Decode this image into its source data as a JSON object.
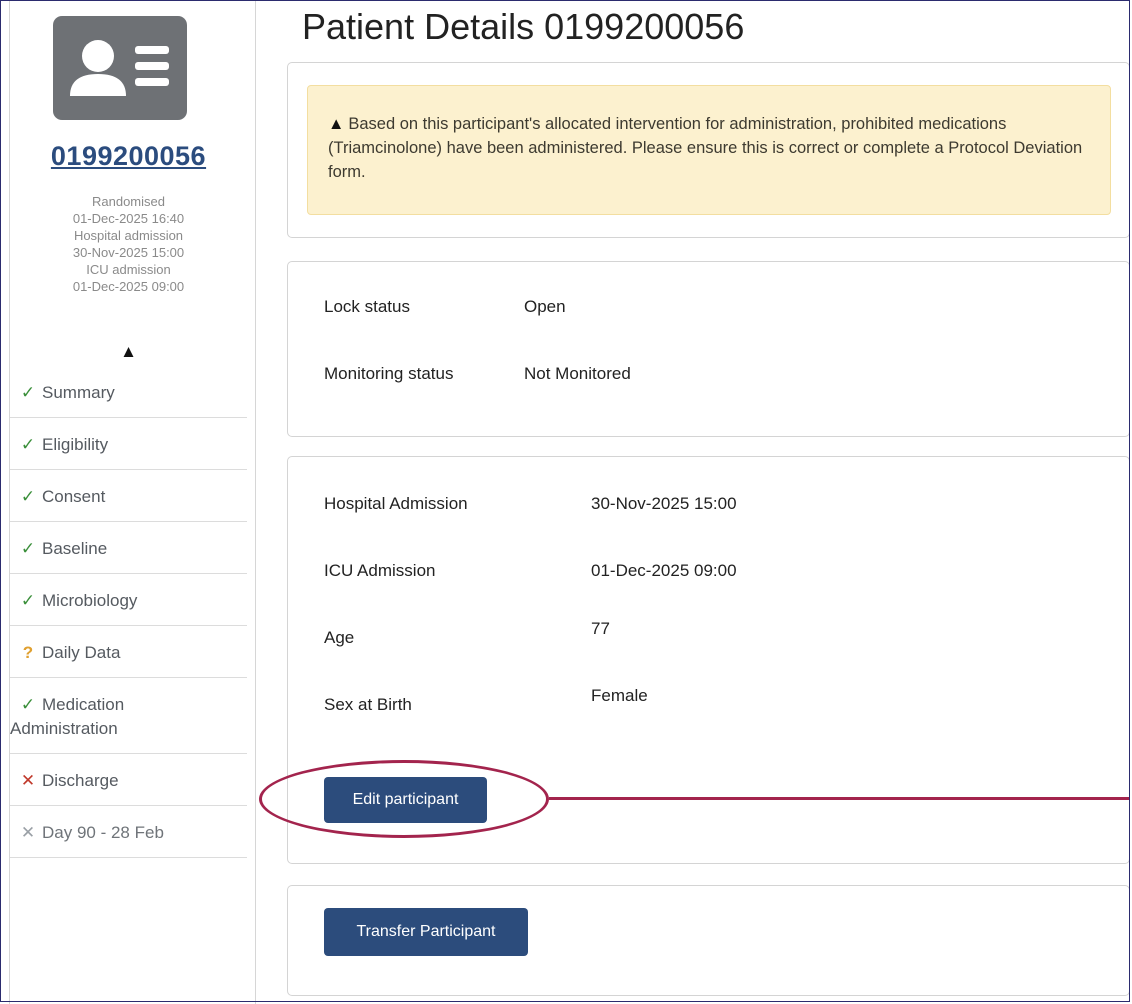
{
  "sidebar": {
    "participant_id": "0199200056",
    "meta": [
      "Randomised",
      "01-Dec-2025 16:40",
      "Hospital admission",
      "30-Nov-2025 15:00",
      "ICU admission",
      "01-Dec-2025 09:00"
    ],
    "warning_glyph": "▲",
    "items": [
      {
        "icon": "✓",
        "label": "Summary",
        "status": "complete"
      },
      {
        "icon": "✓",
        "label": "Eligibility",
        "status": "complete"
      },
      {
        "icon": "✓",
        "label": "Consent",
        "status": "complete"
      },
      {
        "icon": "✓",
        "label": "Baseline",
        "status": "complete"
      },
      {
        "icon": "✓",
        "label": "Microbiology",
        "status": "complete"
      },
      {
        "icon": "?",
        "label": "Daily Data",
        "status": "incomplete"
      },
      {
        "icon": "✓",
        "label_line1": "Medication",
        "label_line2": "Administration",
        "status": "complete"
      },
      {
        "icon": "✕",
        "label": "Discharge",
        "status": "missing"
      },
      {
        "icon": "✕",
        "label": "Day 90 - 28 Feb",
        "status": "not-due"
      }
    ]
  },
  "main": {
    "title": "Patient Details 0199200056",
    "alert": {
      "icon": "▲",
      "text": "Based on this participant's allocated intervention for administration, prohibited medications (Triamcinolone) have been administered. Please ensure this is correct or complete a Protocol Deviation form."
    },
    "status": {
      "lock_label": "Lock status",
      "lock_value": "Open",
      "monitoring_label": "Monitoring status",
      "monitoring_value": "Not Monitored"
    },
    "details": {
      "hospital_admission_label": "Hospital Admission",
      "hospital_admission_value": "30-Nov-2025 15:00",
      "icu_admission_label": "ICU Admission",
      "icu_admission_value": "01-Dec-2025 09:00",
      "age_label": "Age",
      "age_value": "77",
      "sex_label": "Sex at Birth",
      "sex_value": "Female",
      "edit_button": "Edit participant"
    },
    "transfer_button": "Transfer Participant"
  },
  "colors": {
    "brand_button": "#2c4c7c",
    "alert_bg": "#fcf1cf",
    "check": "#3a8f3a",
    "question": "#e0a030",
    "cross": "#c0392b",
    "annotation": "#a3244d"
  }
}
